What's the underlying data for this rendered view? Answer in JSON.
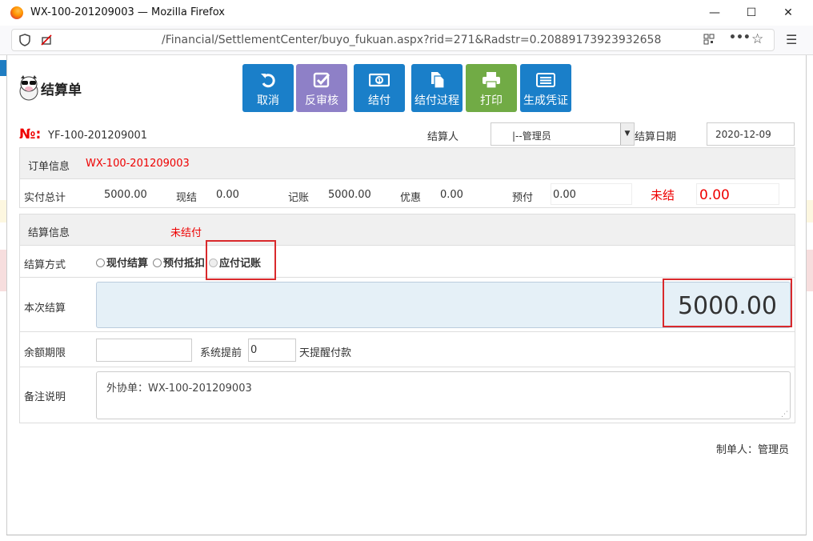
{
  "window": {
    "title": "WX-100-201209003 — Mozilla Firefox",
    "minimize": "—",
    "maximize": "☐",
    "close": "✕"
  },
  "browser": {
    "url": "/Financial/SettlementCenter/buyo_fukuan.aspx?rid=271&Radstr=0.20889173923932658"
  },
  "header": {
    "title": "结算单"
  },
  "toolbar": {
    "cancel": "取消",
    "unaudit": "反审核",
    "settle": "结付",
    "settle_process": "结付过程",
    "print": "打印",
    "voucher": "生成凭证"
  },
  "form": {
    "no_prefix": "№:",
    "no_value": "YF-100-201209001",
    "settler_label": "结算人",
    "settler_value": "|--管理员",
    "date_label": "结算日期",
    "date_value": "2020-12-09"
  },
  "order": {
    "section_label": "订单信息",
    "order_no": "WX-100-201209003",
    "total_label": "实付总计",
    "total_value": "5000.00",
    "cash_label": "现结",
    "cash_value": "0.00",
    "account_label": "记账",
    "account_value": "5000.00",
    "discount_label": "优惠",
    "discount_value": "0.00",
    "prepay_label": "预付",
    "prepay_value": "0.00",
    "unsettled_label": "未结",
    "unsettled_value": "0.00"
  },
  "settlement": {
    "section_label": "结算信息",
    "status": "未结付",
    "method_label": "结算方式",
    "method_options": [
      "现付结算",
      "预付抵扣",
      "应付记账"
    ],
    "amount_label": "本次结算",
    "amount_value": "5000.00",
    "balance_label": "余额期限",
    "remind_label": "系统提前",
    "remind_value": "0",
    "remind_suffix": "天提醒付款",
    "remark_label": "备注说明",
    "remark_value": "外协单：WX-100-201209003"
  },
  "footer": {
    "maker": "制单人：管理员"
  },
  "colors": {
    "button_blue": "#1a7fc9",
    "button_purple": "#8e80c7",
    "button_green": "#71ab45",
    "highlight_red": "#d9292c"
  }
}
